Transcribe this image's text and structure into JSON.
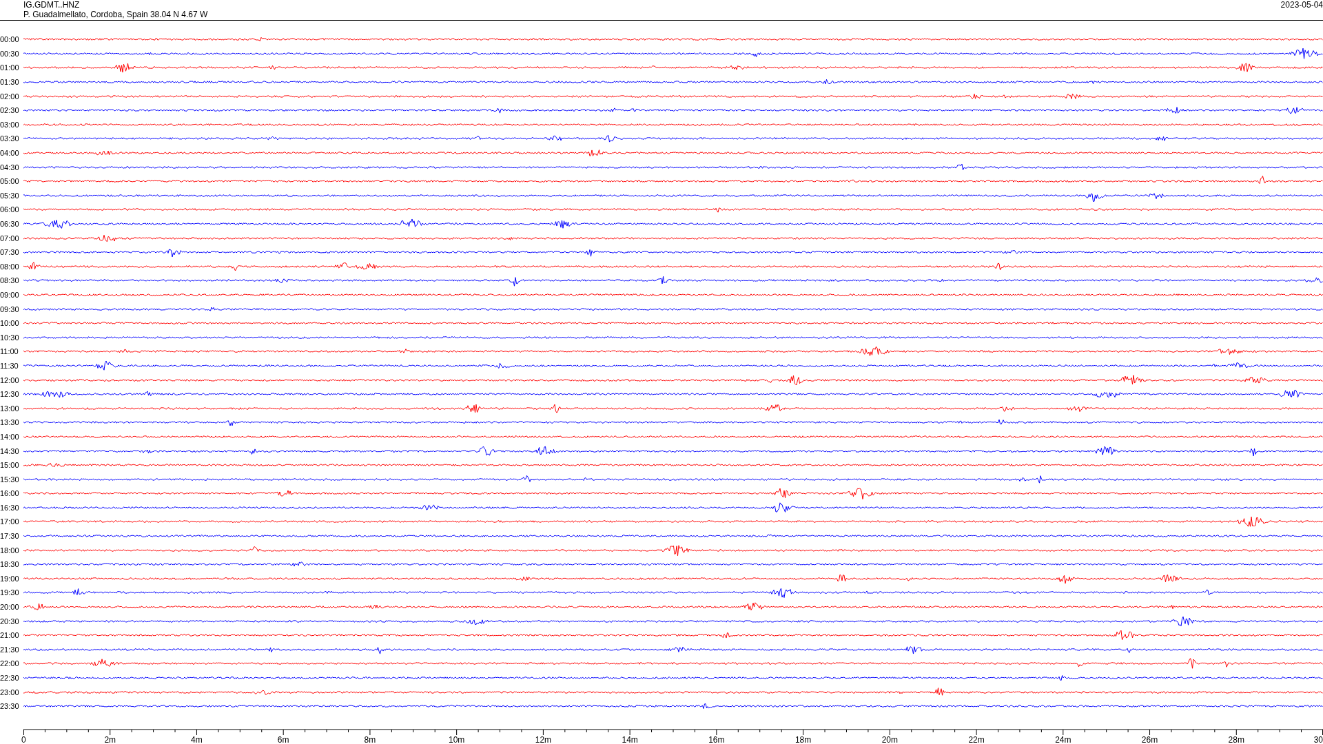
{
  "header": {
    "station": "IG.GDMT..HNZ",
    "location": "P. Guadalmellato, Cordoba, Spain  38.04 N 4.67 W",
    "date": "2023-05-04"
  },
  "rows": [
    {
      "label": "00:00",
      "color": "#ff0000"
    },
    {
      "label": "00:30",
      "color": "#0000ff"
    },
    {
      "label": "01:00",
      "color": "#ff0000"
    },
    {
      "label": "01:30",
      "color": "#0000ff"
    },
    {
      "label": "02:00",
      "color": "#ff0000"
    },
    {
      "label": "02:30",
      "color": "#0000ff"
    },
    {
      "label": "03:00",
      "color": "#ff0000"
    },
    {
      "label": "03:30",
      "color": "#0000ff"
    },
    {
      "label": "04:00",
      "color": "#ff0000"
    },
    {
      "label": "04:30",
      "color": "#0000ff"
    },
    {
      "label": "05:00",
      "color": "#ff0000"
    },
    {
      "label": "05:30",
      "color": "#0000ff"
    },
    {
      "label": "06:00",
      "color": "#ff0000"
    },
    {
      "label": "06:30",
      "color": "#0000ff"
    },
    {
      "label": "07:00",
      "color": "#ff0000"
    },
    {
      "label": "07:30",
      "color": "#0000ff"
    },
    {
      "label": "08:00",
      "color": "#ff0000"
    },
    {
      "label": "08:30",
      "color": "#0000ff"
    },
    {
      "label": "09:00",
      "color": "#ff0000"
    },
    {
      "label": "09:30",
      "color": "#0000ff"
    },
    {
      "label": "10:00",
      "color": "#ff0000"
    },
    {
      "label": "10:30",
      "color": "#0000ff"
    },
    {
      "label": "11:00",
      "color": "#ff0000"
    },
    {
      "label": "11:30",
      "color": "#0000ff"
    },
    {
      "label": "12:00",
      "color": "#ff0000"
    },
    {
      "label": "12:30",
      "color": "#0000ff"
    },
    {
      "label": "13:00",
      "color": "#ff0000"
    },
    {
      "label": "13:30",
      "color": "#0000ff"
    },
    {
      "label": "14:00",
      "color": "#ff0000"
    },
    {
      "label": "14:30",
      "color": "#0000ff"
    },
    {
      "label": "15:00",
      "color": "#ff0000"
    },
    {
      "label": "15:30",
      "color": "#0000ff"
    },
    {
      "label": "16:00",
      "color": "#ff0000"
    },
    {
      "label": "16:30",
      "color": "#0000ff"
    },
    {
      "label": "17:00",
      "color": "#ff0000"
    },
    {
      "label": "17:30",
      "color": "#0000ff"
    },
    {
      "label": "18:00",
      "color": "#ff0000"
    },
    {
      "label": "18:30",
      "color": "#0000ff"
    },
    {
      "label": "19:00",
      "color": "#ff0000"
    },
    {
      "label": "19:30",
      "color": "#0000ff"
    },
    {
      "label": "20:00",
      "color": "#ff0000"
    },
    {
      "label": "20:30",
      "color": "#0000ff"
    },
    {
      "label": "21:00",
      "color": "#ff0000"
    },
    {
      "label": "21:30",
      "color": "#0000ff"
    },
    {
      "label": "22:00",
      "color": "#ff0000"
    },
    {
      "label": "22:30",
      "color": "#0000ff"
    },
    {
      "label": "23:00",
      "color": "#ff0000"
    },
    {
      "label": "23:30",
      "color": "#0000ff"
    }
  ],
  "time_axis": {
    "labels": [
      "0",
      "2m",
      "4m",
      "6m",
      "8m",
      "10m",
      "12m",
      "14m",
      "16m",
      "18m",
      "20m",
      "22m",
      "24m",
      "26m",
      "28m",
      "30"
    ]
  }
}
